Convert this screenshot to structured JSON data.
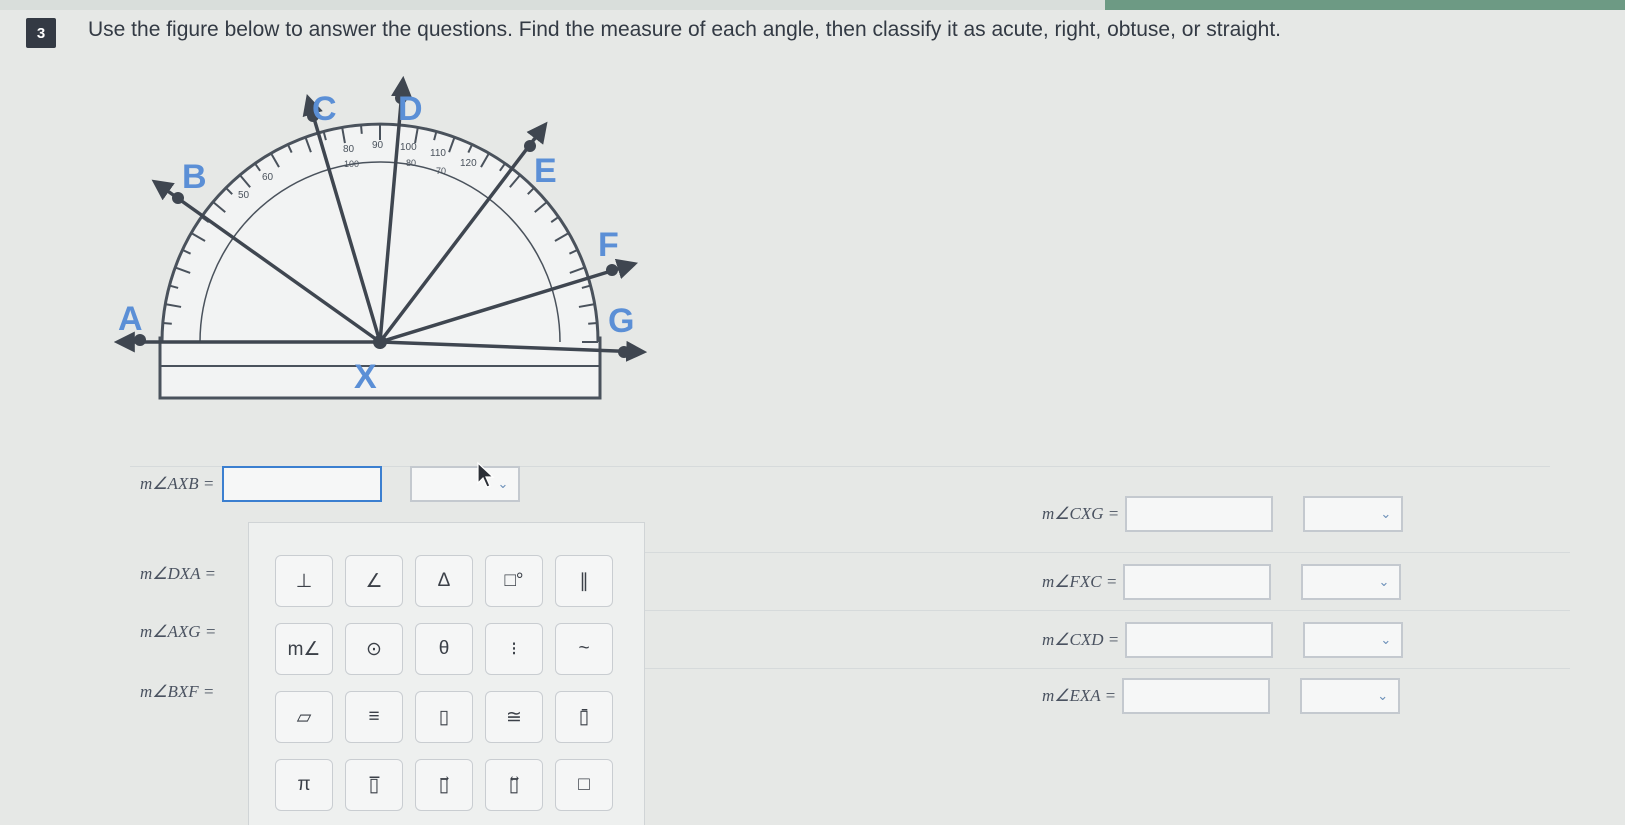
{
  "question": {
    "number": "3",
    "text": "Use the figure below to answer the questions. Find the measure of each angle, then classify it as acute, right, obtuse, or straight."
  },
  "figure": {
    "points": [
      "A",
      "B",
      "C",
      "D",
      "E",
      "F",
      "G",
      "X"
    ],
    "ticks": [
      "80",
      "90",
      "100",
      "110",
      "120",
      "100",
      "80",
      "70",
      "60",
      "50"
    ]
  },
  "left_questions": [
    {
      "label": "m∠AXB ="
    },
    {
      "label": "m∠DXA ="
    },
    {
      "label": "m∠AXG ="
    },
    {
      "label": "m∠BXF ="
    }
  ],
  "right_questions": [
    {
      "label": "m∠CXG ="
    },
    {
      "label": "m∠FXC ="
    },
    {
      "label": "m∠CXD ="
    },
    {
      "label": "m∠EXA ="
    }
  ],
  "palette": {
    "buttons": [
      "⊥",
      "∠",
      "Δ",
      "□°",
      "∥",
      "m∠",
      "⊙",
      "θ",
      "⁝",
      "~",
      "▱",
      "≡",
      "▯",
      "≅",
      "▯̄",
      "π",
      "▯̅",
      "▯⃗",
      "▯⃡",
      "□"
    ]
  },
  "colors": {
    "accent": "#5b8fd6",
    "point_dot": "#3f4650",
    "ray": "#3f4650"
  }
}
